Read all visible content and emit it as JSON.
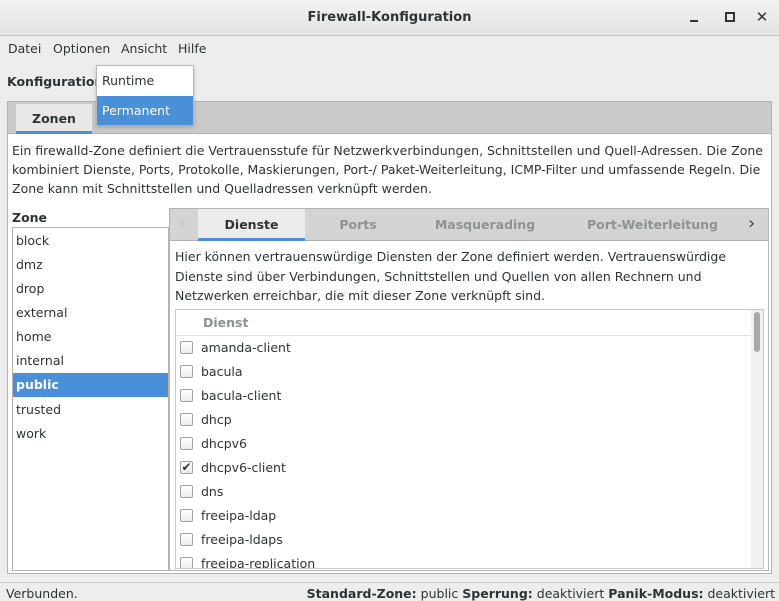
{
  "window": {
    "title": "Firewall-Konfiguration"
  },
  "menu": {
    "items": [
      "Datei",
      "Optionen",
      "Ansicht",
      "Hilfe"
    ]
  },
  "konfiguration": {
    "label": "Konfiguration:",
    "options": [
      "Runtime",
      "Permanent"
    ],
    "selected": "Permanent"
  },
  "outer_tabs": [
    {
      "label": "Zonen",
      "active": true
    }
  ],
  "zone_description": "Ein firewalld-Zone definiert die Vertrauensstufe für Netzwerkverbindungen, Schnittstellen und Quell-Adressen. Die Zone kombiniert Dienste, Ports, Protokolle, Maskierungen, Port-/ Paket-Weiterleitung, ICMP-Filter und umfassende Regeln. Die Zone kann mit Schnittstellen und Quelladressen verknüpft werden.",
  "zones": {
    "title": "Zone",
    "items": [
      "block",
      "dmz",
      "drop",
      "external",
      "home",
      "internal",
      "public",
      "trusted",
      "work"
    ],
    "selected": "public"
  },
  "inner_tabs": [
    "Dienste",
    "Ports",
    "Masquerading",
    "Port-Weiterleitung"
  ],
  "services": {
    "description": "Hier können  vertrauenswürdige Diensten der Zone definiert werden. Vertrauenswürdige Dienste sind über Verbindungen, Schnittstellen und Quellen von allen Rechnern und Netzwerken erreichbar, die mit dieser Zone verknüpft sind.",
    "column_header": "Dienst",
    "rows": [
      {
        "name": "amanda-client",
        "checked": false
      },
      {
        "name": "bacula",
        "checked": false
      },
      {
        "name": "bacula-client",
        "checked": false
      },
      {
        "name": "dhcp",
        "checked": false
      },
      {
        "name": "dhcpv6",
        "checked": false
      },
      {
        "name": "dhcpv6-client",
        "checked": true
      },
      {
        "name": "dns",
        "checked": false
      },
      {
        "name": "freeipa-ldap",
        "checked": false
      },
      {
        "name": "freeipa-ldaps",
        "checked": false
      },
      {
        "name": "freeipa-replication",
        "checked": false
      }
    ]
  },
  "status": {
    "connection": "Verbunden.",
    "default_zone_label": "Standard-Zone:",
    "default_zone": "public",
    "lockdown_label": "Sperrung:",
    "lockdown": "deaktiviert",
    "panic_label": "Panik-Modus:",
    "panic": "deaktiviert"
  },
  "colors": {
    "accent": "#4a90d9",
    "background": "#ededed"
  }
}
